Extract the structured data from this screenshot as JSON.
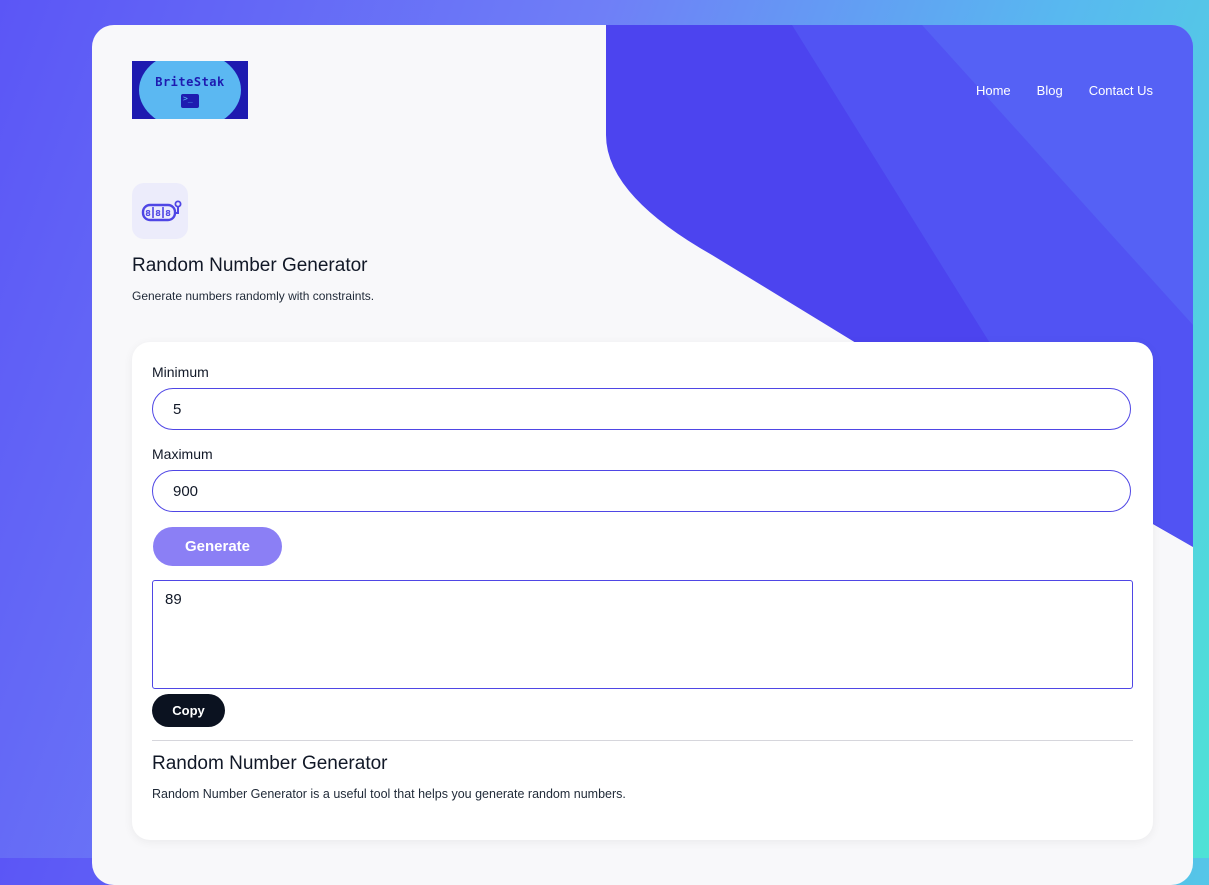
{
  "brand": {
    "logo_text": "BriteStak",
    "logo_glyph": ">_",
    "colors": {
      "logo_bg": "#1e1bb0",
      "logo_circle": "#5bb8f2"
    }
  },
  "nav": {
    "items": [
      {
        "label": "Home"
      },
      {
        "label": "Blog"
      },
      {
        "label": "Contact Us"
      }
    ]
  },
  "tool": {
    "icon": "slot-machine-icon",
    "title": "Random Number Generator",
    "subtitle": "Generate numbers randomly with constraints."
  },
  "form": {
    "minimum_label": "Minimum",
    "minimum_value": "5",
    "maximum_label": "Maximum",
    "maximum_value": "900",
    "generate_label": "Generate",
    "result_value": "89",
    "copy_label": "Copy"
  },
  "info": {
    "title": "Random Number Generator",
    "text": "Random Number Generator is a useful tool that helps you generate random numbers."
  },
  "colors": {
    "accent": "#4f46e5",
    "generate_button": "#8b7ff5",
    "copy_button": "#0b1220"
  }
}
